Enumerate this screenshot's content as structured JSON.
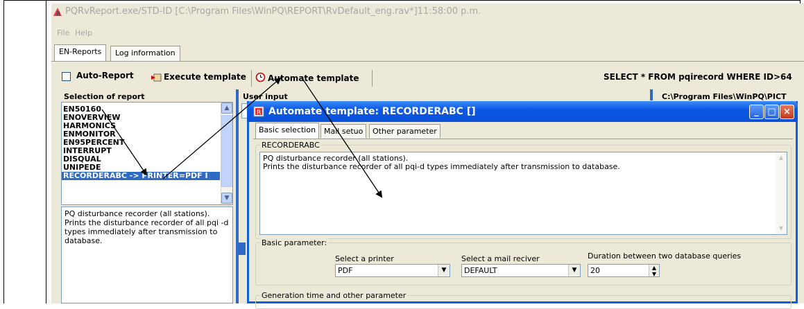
{
  "app": {
    "title": "PQRvReport.exe/STD-ID [C:\\Program Files\\WinPQ\\REPORT\\RvDefault_eng.rav*]11:58:00 p.m.",
    "menu": [
      "File",
      "Help"
    ],
    "tabs": [
      "EN-Reports",
      "Log information"
    ],
    "toolbar": {
      "auto_report": "Auto-Report",
      "execute_template": "Execute template",
      "automate_template": "Automate template",
      "sql": "SELECT * FROM pqirecord WHERE ID>64"
    },
    "selection_panel": {
      "title": "Selection of report",
      "items": [
        "EN50160",
        "ENOVERVIEW",
        "HARMONICS",
        "ENMONITOR",
        "EN95PERCENT",
        "INTERRUPT",
        "DISQUAL",
        "UNIPEDE",
        "RECORDERABC -> PRINTER=PDF I"
      ],
      "selected_index": 8,
      "description": "PQ disturbance recorder (all stations). Prints the disturbance recorder of all pqi -d types immediately after transmission to database."
    },
    "user_input_title": "User input",
    "path_label": "C:\\Program Files\\WinPQ\\PICT"
  },
  "dialog": {
    "title": "Automate template: RECORDERABC []",
    "tabs": [
      "Basic selection",
      "Mail setuo",
      "Other parameter"
    ],
    "group_title": "RECORDERABC",
    "description_line1": "PQ disturbance recorder (all stations).",
    "description_line2": "Prints the disturbance recorder of all pqi-d types immediately after transmission to database.",
    "basic_parameter_title": "Basic parameter:",
    "printer_label": "Select a printer",
    "printer_value": "PDF",
    "mail_label": "Select a mail reciver",
    "mail_value": "DEFAULT",
    "duration_label": "Duration between two database queries",
    "duration_value": "20",
    "generation_title": "Generation time and other parameter"
  },
  "colors": {
    "selection": "#316ac5",
    "dialog_title": "#0a52d8",
    "panel_bg": "#ece9d8"
  }
}
